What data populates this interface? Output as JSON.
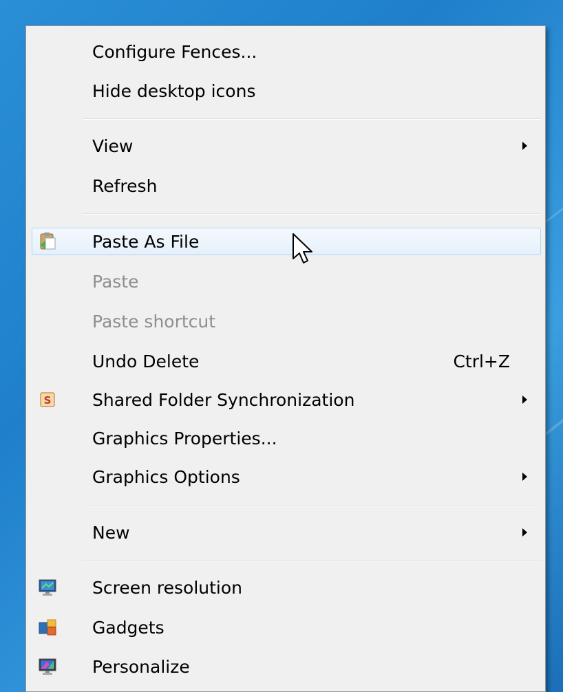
{
  "menu": {
    "items": [
      {
        "label": "Configure Fences..."
      },
      {
        "label": "Hide desktop icons"
      },
      {
        "label": "View"
      },
      {
        "label": "Refresh"
      },
      {
        "label": "Paste As File"
      },
      {
        "label": "Paste"
      },
      {
        "label": "Paste shortcut"
      },
      {
        "label": "Undo Delete",
        "shortcut": "Ctrl+Z"
      },
      {
        "label": "Shared Folder Synchronization"
      },
      {
        "label": "Graphics Properties..."
      },
      {
        "label": "Graphics Options"
      },
      {
        "label": "New"
      },
      {
        "label": "Screen resolution"
      },
      {
        "label": "Gadgets"
      },
      {
        "label": "Personalize"
      }
    ],
    "shared_folder_icon_letter": "S"
  },
  "colors": {
    "menu_bg": "#f0f0f0",
    "hover_border": "#a8d8f8",
    "disabled_text": "#8f8f8f"
  },
  "icons": {
    "paste_as_file": "paste-as-file-icon",
    "shared_folder": "shared-folder-sync-icon",
    "screen_resolution": "screen-resolution-icon",
    "gadgets": "gadgets-icon",
    "personalize": "personalize-icon"
  }
}
